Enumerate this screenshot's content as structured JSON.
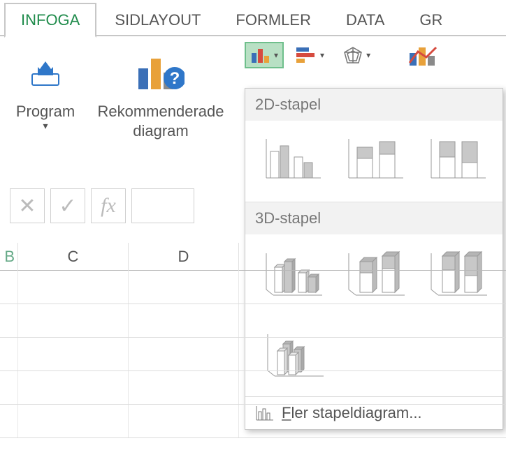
{
  "ribbon": {
    "tabs": [
      "INFOGA",
      "SIDLAYOUT",
      "FORMLER",
      "DATA",
      "GR"
    ],
    "active_tab_index": 0,
    "apps": {
      "label": "Program"
    },
    "recommended": {
      "label_line1": "Rekommenderade",
      "label_line2": "diagram"
    }
  },
  "dropdown": {
    "section_2d": "2D-stapel",
    "section_3d": "3D-stapel",
    "more_label": "ler stapeldiagram...",
    "more_accel": "F"
  },
  "sheet": {
    "edge_letter": "B",
    "columns": [
      "C",
      "D"
    ]
  }
}
